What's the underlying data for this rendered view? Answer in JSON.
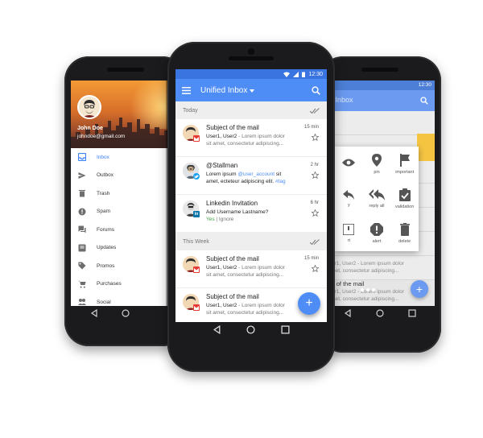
{
  "colors": {
    "primary": "#4e8df5",
    "status_bar": "#3a74e0",
    "accent_link": "#4e8df5",
    "ignore_yes": "#43a047",
    "drawer_active": "#3b82f6"
  },
  "left_phone": {
    "profile": {
      "name": "John Doe",
      "email": "johndoe@gmail.com"
    },
    "drawer_items": [
      {
        "label": "Inbox",
        "icon": "inbox-icon",
        "active": true
      },
      {
        "label": "Outbox",
        "icon": "send-icon"
      },
      {
        "label": "Trash",
        "icon": "trash-icon"
      },
      {
        "label": "Spam",
        "icon": "spam-icon"
      },
      {
        "label": "Forums",
        "icon": "forum-icon"
      },
      {
        "label": "Updates",
        "icon": "updates-icon"
      },
      {
        "label": "Promos",
        "icon": "tag-icon"
      },
      {
        "label": "Purchases",
        "icon": "cart-icon"
      },
      {
        "label": "Social",
        "icon": "people-icon"
      }
    ]
  },
  "center_phone": {
    "status_time": "12:30",
    "app_title": "Unified Inbox",
    "sections": [
      {
        "title": "Today",
        "mails": [
          {
            "subject": "Subject of the mail",
            "users": "User1, User2",
            "snippet": " - Lorem ipsum dolor",
            "line3": "sit amet, consectetur adipiscing...",
            "time": "15 min",
            "badge": "gmail"
          },
          {
            "subject": "@Stallman",
            "line2_a": "Lorem ipsum ",
            "line2_link": "@user_account",
            "line2_b": " sit",
            "line3_a": "amet, ecteteur adipiscing elit. ",
            "line3_tag": "#tag",
            "time": "2 hr",
            "badge": "twitter"
          },
          {
            "subject": "Linkedin Invitation",
            "line2": "Add Username Lastname?",
            "yes": "Yes",
            "sep": " | ",
            "ignore": "Ignore",
            "time": "6 hr",
            "badge": "linkedin"
          }
        ]
      },
      {
        "title": "This Week",
        "mails": [
          {
            "subject": "Subject of the mail",
            "users": "User1, User2",
            "snippet": " - Lorem ipsum dolor",
            "line3": "sit amet, consectetur adipiscing...",
            "time": "15 min",
            "badge": "gmail"
          },
          {
            "subject": "Subject of the mail",
            "users": "User1, User2",
            "snippet": " - Lorem ipsum dolor",
            "line3": "sit amet, consectetur adipiscing...",
            "time": "",
            "badge": "gmail"
          }
        ]
      }
    ],
    "fab_label": "+"
  },
  "right_phone": {
    "status_time": "12:30",
    "app_title_partial": "ed Inbox",
    "actions": [
      {
        "label": "",
        "icon": "eye-icon"
      },
      {
        "label": "pin",
        "icon": "pin-icon"
      },
      {
        "label": "important",
        "icon": "flag-icon"
      },
      {
        "label": "y",
        "icon": "reply-icon"
      },
      {
        "label": "reply all",
        "icon": "reply-all-icon"
      },
      {
        "label": "validation",
        "icon": "clipboard-check-icon"
      },
      {
        "label": "rt",
        "icon": "report-icon"
      },
      {
        "label": "alert",
        "icon": "alert-icon"
      },
      {
        "label": "delete",
        "icon": "delete-icon"
      }
    ],
    "snippets": [
      "User1, User2 - Lorem ipsum dolor",
      "t amet, consectetur adipiscing...",
      "ject of the mail",
      "User1, User2 - Lorem ipsum dolor",
      "t amet, consectetur adipiscing..."
    ],
    "fab_label": "+"
  }
}
